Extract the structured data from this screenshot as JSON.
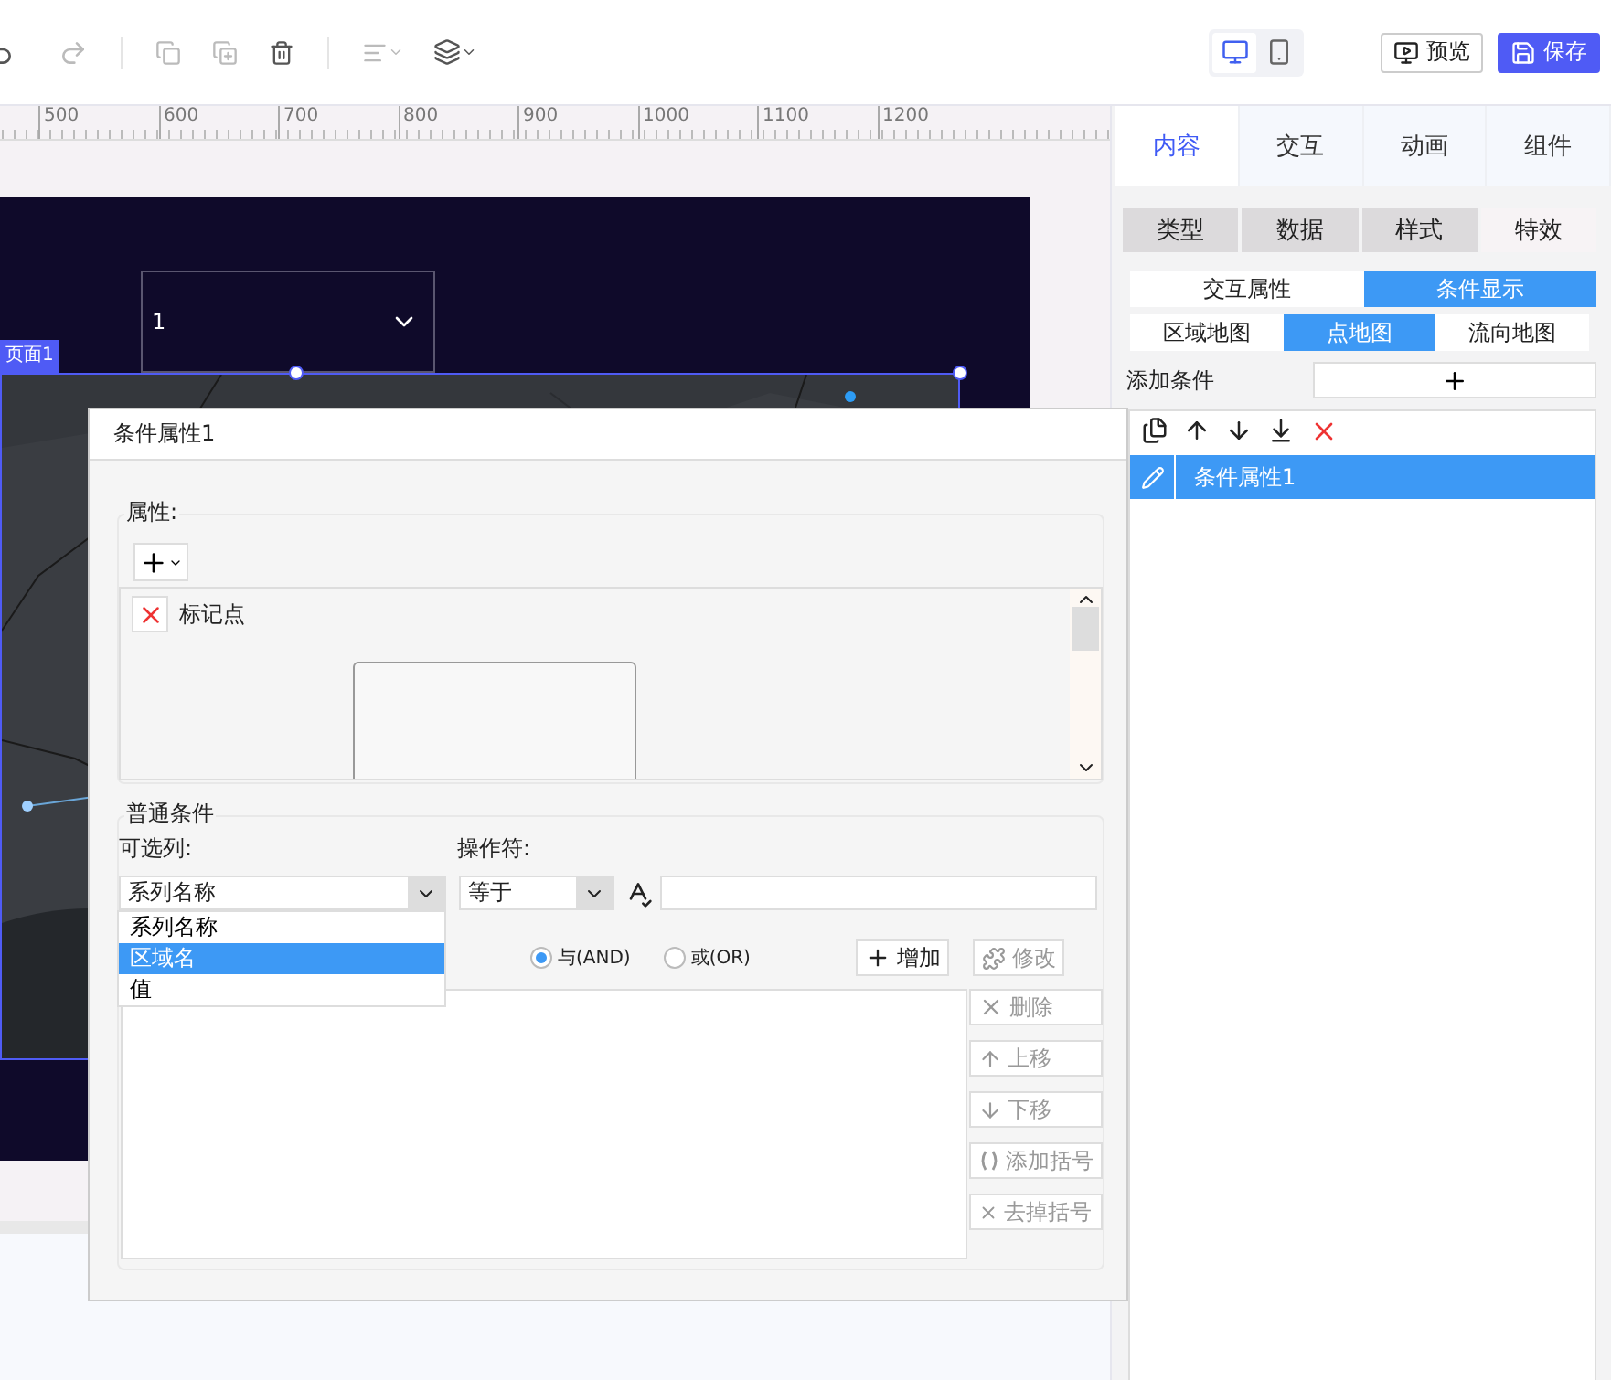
{
  "toolbar": {
    "devices": [
      {
        "kind": "desktop",
        "selected": true
      },
      {
        "kind": "mobile",
        "selected": false
      }
    ],
    "buttons": [
      {
        "label": "预览",
        "kind": "outline"
      },
      {
        "label": "保存",
        "kind": "primary"
      }
    ]
  },
  "ruler": {
    "ticks": [
      "500",
      "600",
      "700",
      "800",
      "900",
      "1000",
      "1100",
      "1200"
    ]
  },
  "canvas": {
    "page_tag": "页面1",
    "dropdown_value": "1"
  },
  "right_panel": {
    "tabs": [
      {
        "label": "内容",
        "selected": true
      },
      {
        "label": "交互",
        "selected": false
      },
      {
        "label": "动画",
        "selected": false
      },
      {
        "label": "组件",
        "selected": false
      }
    ],
    "subtabs": [
      {
        "label": "类型",
        "selected": false
      },
      {
        "label": "数据",
        "selected": false
      },
      {
        "label": "样式",
        "selected": false
      },
      {
        "label": "特效",
        "selected": true
      }
    ],
    "mode_tabs": [
      {
        "label": "交互属性",
        "selected": false
      },
      {
        "label": "条件显示",
        "selected": true
      }
    ],
    "map_tabs": [
      {
        "label": "区域地图",
        "selected": false
      },
      {
        "label": "点地图",
        "selected": true
      },
      {
        "label": "流向地图",
        "selected": false
      }
    ],
    "add_condition_label": "添加条件",
    "conditions": [
      {
        "label": "条件属性1",
        "selected": true
      }
    ]
  },
  "dialog": {
    "title": "条件属性1",
    "attributes_legend": "属性:",
    "attributes": [
      {
        "label": "标记点"
      }
    ],
    "conditions_legend": "普通条件",
    "column_label": "可选列:",
    "column_value": "系列名称",
    "column_options": [
      {
        "label": "系列名称",
        "selected": false
      },
      {
        "label": "区域名",
        "selected": true
      },
      {
        "label": "值",
        "selected": false
      }
    ],
    "operator_label": "操作符:",
    "operator_value": "等于",
    "logic": [
      {
        "label": "与(AND)",
        "selected": true
      },
      {
        "label": "或(OR)",
        "selected": false
      }
    ],
    "add_button": "增加",
    "modify_button": "修改",
    "side_buttons": [
      {
        "kind": "delete",
        "label": "删除"
      },
      {
        "kind": "up",
        "label": "上移"
      },
      {
        "kind": "down",
        "label": "下移"
      },
      {
        "kind": "add_paren",
        "label": "添加括号"
      },
      {
        "kind": "remove_paren",
        "label": "去掉括号"
      }
    ]
  }
}
